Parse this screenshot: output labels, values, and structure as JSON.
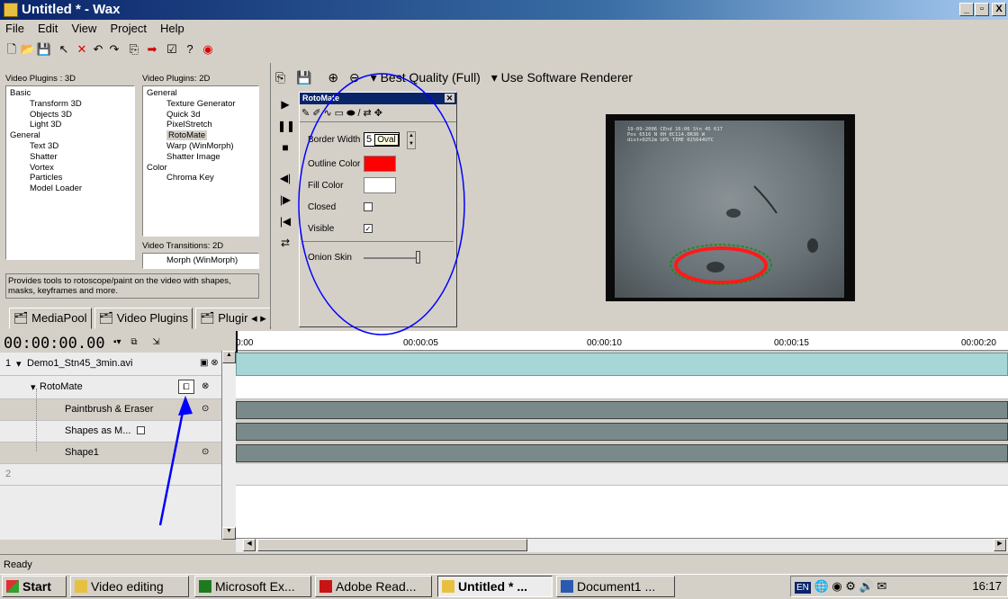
{
  "window": {
    "title": "Untitled * - Wax",
    "controls": [
      "_",
      "▫",
      "X"
    ]
  },
  "menu": [
    "File",
    "Edit",
    "View",
    "Project",
    "Help"
  ],
  "plugins3d": {
    "header": "Video Plugins : 3D",
    "items": [
      "Basic",
      "Transform 3D",
      "Objects 3D",
      "Light 3D",
      "General",
      "Text 3D",
      "Shatter",
      "Vortex",
      "Particles",
      "Model Loader"
    ]
  },
  "plugins2d": {
    "header": "Video Plugins: 2D",
    "items": [
      "General",
      "Texture Generator",
      "Quick 3d",
      "PixelStretch",
      "RotoMate",
      "Warp (WinMorph)",
      "Shatter Image",
      "Color",
      "Chroma Key"
    ]
  },
  "transitions": {
    "header": "Video Transitions: 2D",
    "item": "Morph (WinMorph)"
  },
  "description": "Provides tools to rotoscope/paint on the video with shapes, masks, keyframes and more.",
  "tabs": [
    "MediaPool",
    "Video Plugins",
    "Plugir"
  ],
  "preview_toolbar": {
    "quality": "Best Quality (Full)",
    "renderer": "Use Software Renderer"
  },
  "rotomate": {
    "title": "RotoMate",
    "tooltip": "Oval",
    "fields": {
      "border_width_label": "Border Width",
      "border_width_value": "5",
      "outline_color_label": "Outline Color",
      "fill_color_label": "Fill Color",
      "closed_label": "Closed",
      "visible_label": "Visible",
      "onion_skin_label": "Onion Skin"
    },
    "outline_color": "#ff0000",
    "fill_color": "#ffffff",
    "closed_checked": "",
    "visible_checked": "✓"
  },
  "video_overlay": [
    "19-09-2006 CEnd 16:06 Stn 45 617",
    "Pos 6516 N 0H 0C114.0R36 W",
    "dist+0252m GPS TIME 025644UTC"
  ],
  "timeline": {
    "timecode": "00:00:00.00",
    "ruler": [
      "0:00",
      "00:00:05",
      "00:00:10",
      "00:00:15",
      "00:00:20"
    ],
    "tracks": [
      {
        "num": "1",
        "label": "Demo1_Stn45_3min.avi"
      },
      {
        "label": "RotoMate"
      },
      {
        "label": "Paintbrush & Eraser"
      },
      {
        "label": "Shapes as M..."
      },
      {
        "label": "Shape1"
      },
      {
        "num": "2",
        "label": ""
      }
    ]
  },
  "status": "Ready",
  "taskbar": {
    "start": "Start",
    "items": [
      "Video editing",
      "Microsoft Ex...",
      "Adobe Read...",
      "Untitled * ...",
      "Document1 ..."
    ],
    "lang": "EN",
    "clock": "16:17"
  },
  "colors": {
    "title_blue": "#0a246a",
    "track_teal": "#a6d6d6",
    "track_gray": "#7a8a8a",
    "annotation_blue": "#0000ff"
  }
}
